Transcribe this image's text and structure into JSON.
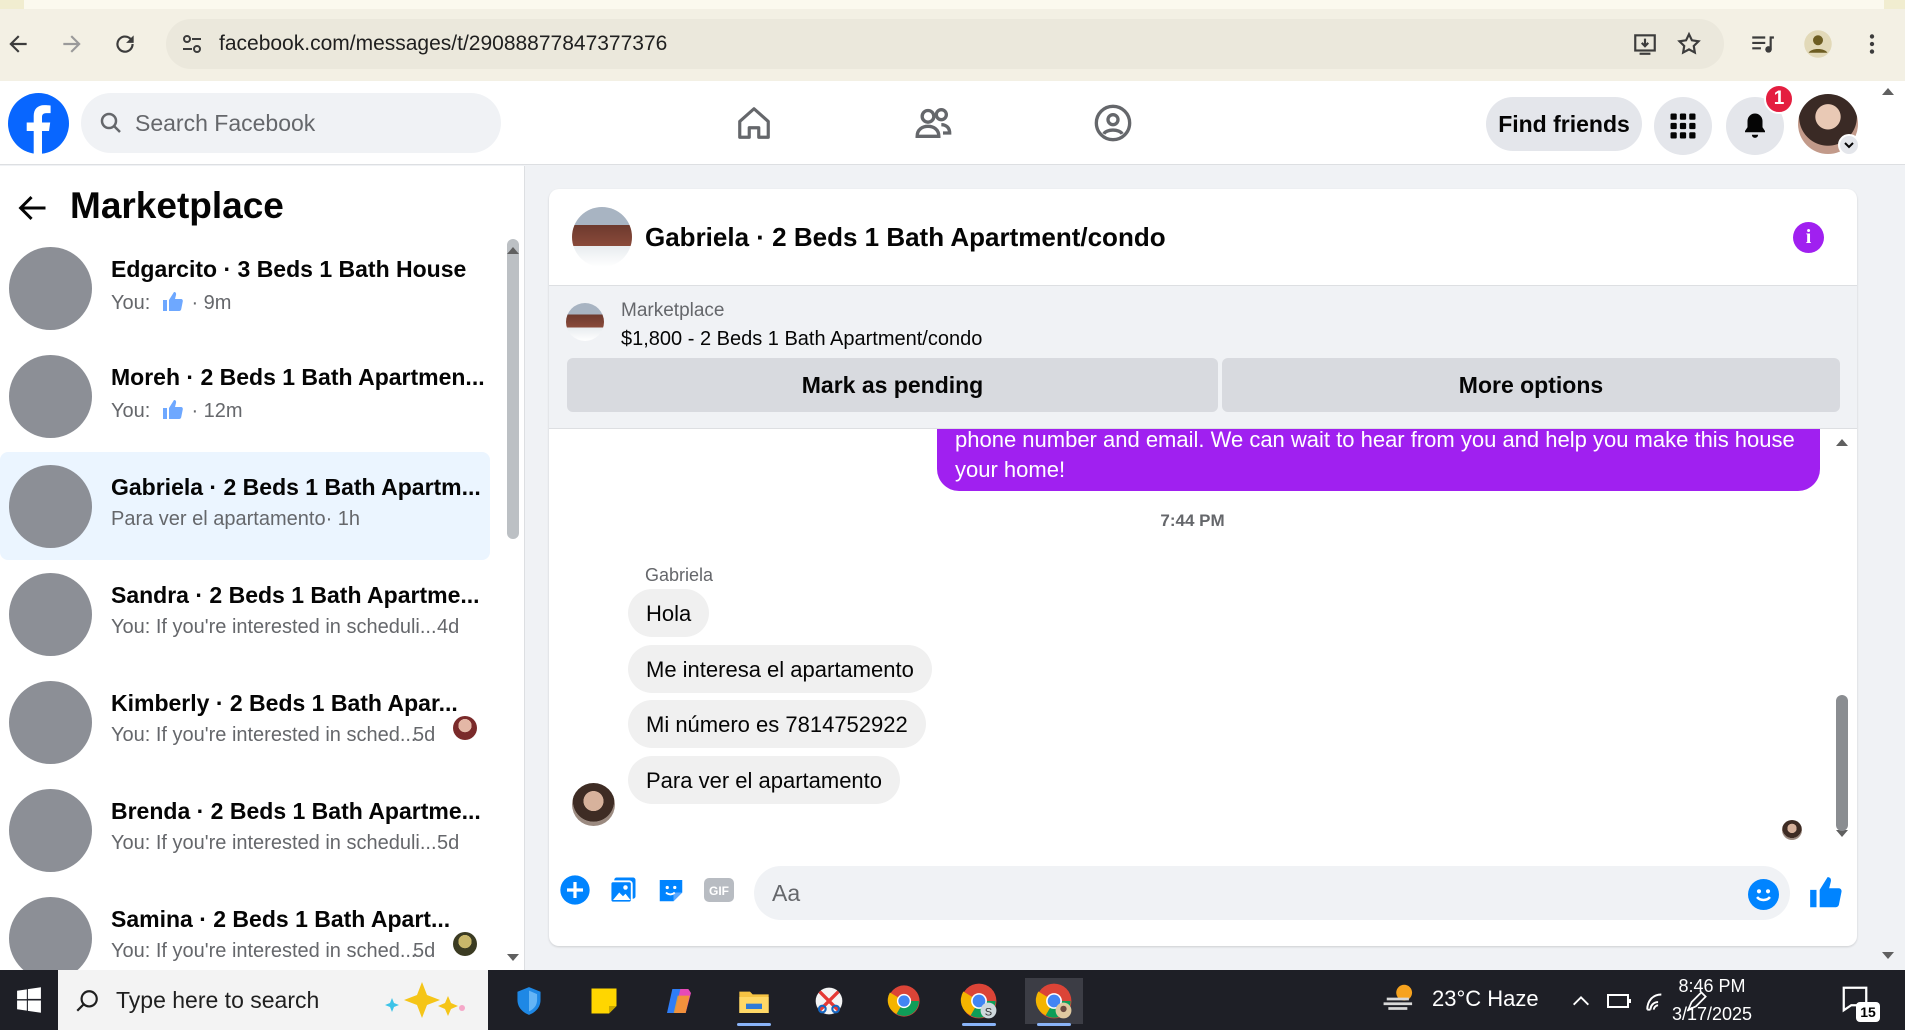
{
  "browser": {
    "url": "facebook.com/messages/t/29088877847377376"
  },
  "fb": {
    "search_placeholder": "Search Facebook",
    "find_friends_label": "Find friends",
    "notification_count": "1"
  },
  "sidebar": {
    "title": "Marketplace",
    "conversations": [
      {
        "name": "Edgarcito · 3 Beds 1 Bath House",
        "preview": "You:",
        "time": "· 9m",
        "has_like": true
      },
      {
        "name": "Moreh · 2 Beds 1 Bath Apartmen...",
        "preview": "You:",
        "time": "· 12m",
        "has_like": true
      },
      {
        "name": "Gabriela · 2 Beds 1 Bath Apartm...",
        "preview": "Para ver el apartamento",
        "time": "· 1h",
        "active": true
      },
      {
        "name": "Sandra · 2 Beds 1 Bath Apartme...",
        "preview": "You: If you're interested in scheduli...",
        "time": "4d"
      },
      {
        "name": "Kimberly · 2 Beds 1 Bath Apar...",
        "preview": "You: If you're interested in sched...",
        "time": "5d"
      },
      {
        "name": "Brenda · 2 Beds 1 Bath Apartme...",
        "preview": "You: If you're interested in scheduli...",
        "time": "5d"
      },
      {
        "name": "Samina · 2 Beds 1 Bath Apart...",
        "preview": "You: If you're interested in sched...",
        "time": "5d"
      }
    ]
  },
  "chat": {
    "title": "Gabriela · 2 Beds 1 Bath Apartment/condo",
    "marketplace_label": "Marketplace",
    "listing": "$1,800 - 2 Beds 1 Bath Apartment/condo",
    "mark_pending_label": "Mark as pending",
    "more_options_label": "More options",
    "outgoing_partial": "phone number and email. We can  wait to hear from you and help you make this house your home!",
    "timestamp": "7:44 PM",
    "sender_name": "Gabriela",
    "incoming_messages": [
      "Hola",
      "Me interesa el apartamento",
      "Mi número es 7814752922",
      "Para ver el apartamento"
    ],
    "input_placeholder": "Aa"
  },
  "taskbar": {
    "search_placeholder": "Type here to search",
    "weather": "23°C  Haze",
    "time": "8:46 PM",
    "date": "3/17/2025",
    "notification_count": "15"
  },
  "colors": {
    "fb_blue": "#0866ff",
    "messenger_purple": "#a020f0",
    "active_conv_bg": "#ebf5ff"
  }
}
